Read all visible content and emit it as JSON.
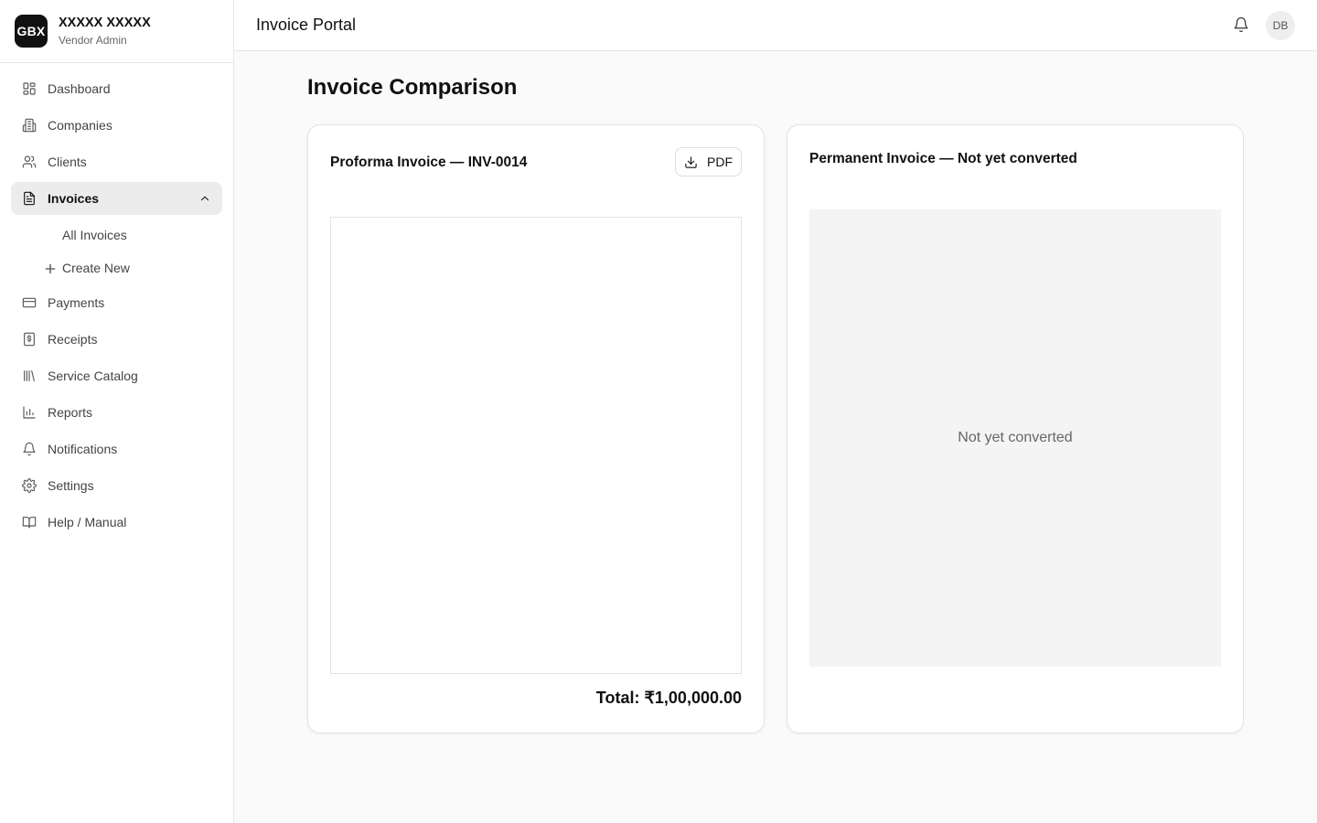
{
  "brand": {
    "logo_text": "GBX",
    "name": "XXXXX XXXXX",
    "role": "Vendor Admin"
  },
  "sidebar": {
    "items": [
      {
        "label": "Dashboard",
        "icon": "dashboard-icon"
      },
      {
        "label": "Companies",
        "icon": "building-icon"
      },
      {
        "label": "Clients",
        "icon": "users-icon"
      },
      {
        "label": "Invoices",
        "icon": "file-text-icon",
        "active": true,
        "expanded": true
      },
      {
        "label": "Payments",
        "icon": "credit-card-icon"
      },
      {
        "label": "Receipts",
        "icon": "receipt-icon"
      },
      {
        "label": "Service Catalog",
        "icon": "library-icon"
      },
      {
        "label": "Reports",
        "icon": "bar-chart-icon"
      },
      {
        "label": "Notifications",
        "icon": "bell-icon"
      },
      {
        "label": "Settings",
        "icon": "gear-icon"
      },
      {
        "label": "Help / Manual",
        "icon": "book-icon"
      }
    ],
    "invoice_sub": {
      "all": "All Invoices",
      "create": "Create New"
    }
  },
  "header": {
    "title": "Invoice Portal",
    "avatar": "DB"
  },
  "main": {
    "title": "Invoice Comparison",
    "proforma": {
      "title": "Proforma Invoice — INV-0014",
      "pdf_label": "PDF",
      "total": "Total: ₹1,00,000.00"
    },
    "permanent": {
      "title": "Permanent Invoice — Not yet converted",
      "placeholder": "Not yet converted"
    }
  },
  "colors": {
    "active_bg": "#ececec",
    "logo_bg": "#111111",
    "placeholder_bg": "#f4f4f4"
  }
}
